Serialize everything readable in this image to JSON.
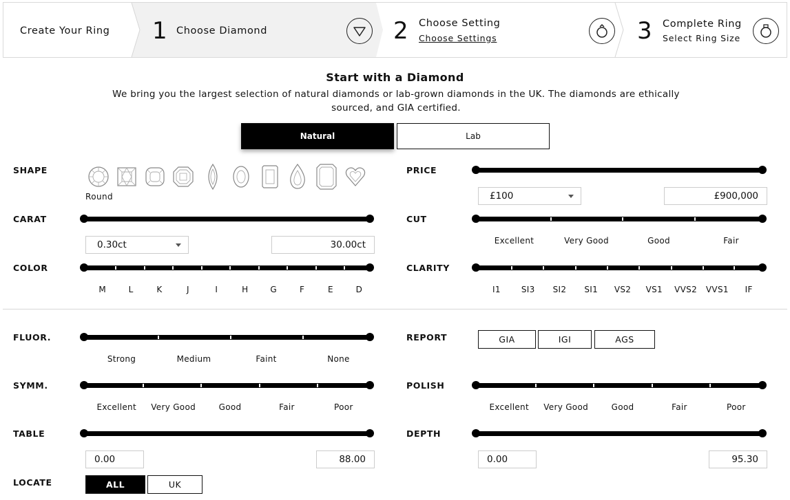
{
  "steps": {
    "create": "Create Your Ring",
    "step1": {
      "num": "1",
      "title": "Choose Diamond",
      "icon": "diamond-icon"
    },
    "step2": {
      "num": "2",
      "title": "Choose Setting",
      "sub": "Choose Settings",
      "icon": "ring-icon"
    },
    "step3": {
      "num": "3",
      "title": "Complete Ring",
      "sub": "Select Ring Size",
      "icon": "ring-icon"
    }
  },
  "intro": {
    "title": "Start with a Diamond",
    "desc": "We bring you the largest selection of natural diamonds or lab-grown diamonds in the UK. The diamonds are ethically sourced, and GIA certified."
  },
  "type_toggle": {
    "natural": "Natural",
    "lab": "Lab",
    "selected": "Natural"
  },
  "filters": {
    "shape": {
      "label": "SHAPE",
      "selected": "Round",
      "items": [
        "round-icon",
        "princess-icon",
        "cushion-icon",
        "asscher-icon",
        "marquise-icon",
        "oval-icon",
        "radiant-icon",
        "pear-icon",
        "emerald-icon",
        "heart-icon"
      ]
    },
    "price": {
      "label": "PRICE",
      "min": "£100",
      "max": "£900,000"
    },
    "carat": {
      "label": "CARAT",
      "min": "0.30ct",
      "max": "30.00ct"
    },
    "cut": {
      "label": "CUT",
      "ticks": [
        "Excellent",
        "Very Good",
        "Good",
        "Fair"
      ]
    },
    "color": {
      "label": "COLOR",
      "ticks": [
        "M",
        "L",
        "K",
        "J",
        "I",
        "H",
        "G",
        "F",
        "E",
        "D"
      ]
    },
    "clarity": {
      "label": "CLARITY",
      "ticks": [
        "I1",
        "SI3",
        "SI2",
        "SI1",
        "VS2",
        "VS1",
        "VVS2",
        "VVS1",
        "IF"
      ]
    },
    "fluor": {
      "label": "FLUOR.",
      "ticks": [
        "Strong",
        "Medium",
        "Faint",
        "None"
      ]
    },
    "report": {
      "label": "REPORT",
      "options": [
        "GIA",
        "IGI",
        "AGS"
      ]
    },
    "symm": {
      "label": "SYMM.",
      "ticks": [
        "Excellent",
        "Very Good",
        "Good",
        "Fair",
        "Poor"
      ]
    },
    "polish": {
      "label": "POLISH",
      "ticks": [
        "Excellent",
        "Very Good",
        "Good",
        "Fair",
        "Poor"
      ]
    },
    "table": {
      "label": "TABLE",
      "min": "0.00",
      "max": "88.00"
    },
    "depth": {
      "label": "DEPTH",
      "min": "0.00",
      "max": "95.30"
    },
    "locate": {
      "label": "LOCATE",
      "options": [
        "ALL",
        "UK"
      ],
      "selected": "ALL"
    }
  }
}
